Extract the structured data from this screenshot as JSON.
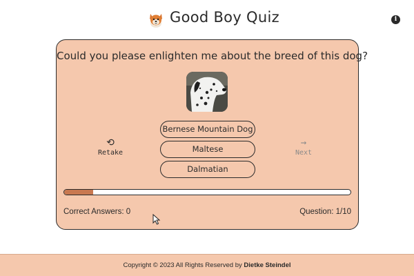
{
  "header": {
    "title": "Good Boy Quiz",
    "logo_icon": "dog-face-icon",
    "info_icon": "info-icon"
  },
  "quiz": {
    "question": "Could you please enlighten me about the breed of this dog?",
    "image_icon": "dalmatian-photo",
    "options": [
      "Bernese Mountain Dog",
      "Maltese",
      "Dalmatian"
    ],
    "retake_label": "Retake",
    "retake_icon": "repeat-icon",
    "next_label": "Next",
    "next_icon": "arrow-right-icon",
    "progress": 0.1,
    "correct_answers": "Correct Answers: 0",
    "question_count": "Question: 1/10"
  },
  "footer": {
    "copyright": "Copyright © 2023 All Rights Reserved by",
    "author": "Dietke Steindel"
  },
  "colors": {
    "card_bg": "#f5c8ad",
    "progress_fill": "#c87850",
    "border": "#2a2a2a",
    "disabled": "#8a8a8a"
  }
}
